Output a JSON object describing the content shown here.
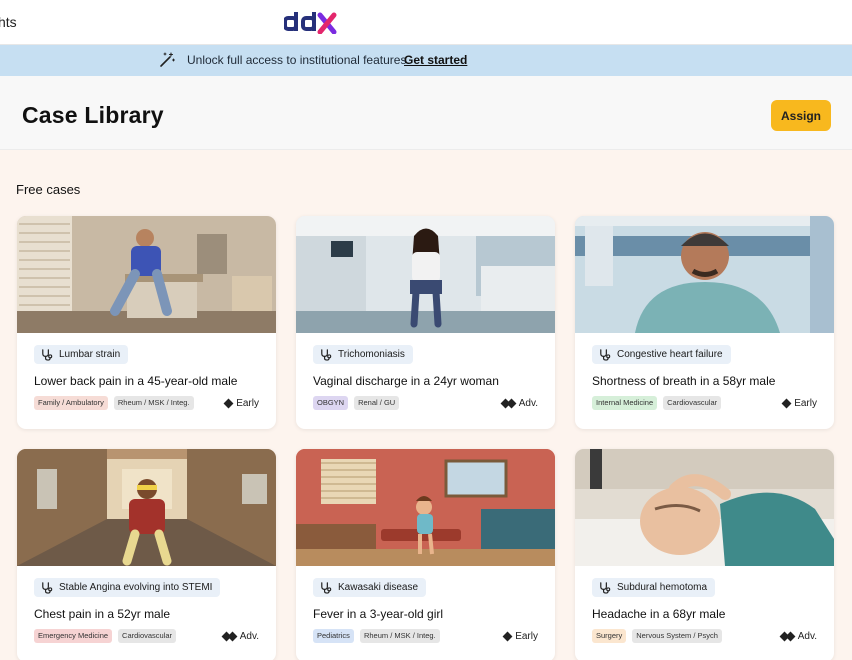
{
  "topbar": {
    "nav_fragment": "hts",
    "logo_text": "ddx"
  },
  "banner": {
    "text": "Unlock full access to institutional features.",
    "link": "Get started"
  },
  "header": {
    "title": "Case Library",
    "assign_label": "Assign"
  },
  "section": {
    "title": "Free cases"
  },
  "cards": [
    {
      "diagnosis": "Lumbar strain",
      "title": "Lower back pain in a 45-year-old male",
      "tags": [
        {
          "label": "Family / Ambulatory",
          "color": "#f6dcd6"
        },
        {
          "label": "Rheum / MSK / Integ.",
          "color": "#e6e6e6"
        }
      ],
      "level": "Early",
      "level_icon": "single-diamond-icon"
    },
    {
      "diagnosis": "Trichomoniasis",
      "title": "Vaginal discharge in a 24yr woman",
      "tags": [
        {
          "label": "OBGYN",
          "color": "#ddd6f1"
        },
        {
          "label": "Renal / GU",
          "color": "#e6e6e6"
        }
      ],
      "level": "Adv.",
      "level_icon": "double-diamond-icon"
    },
    {
      "diagnosis": "Congestive heart failure",
      "title": "Shortness of breath in a 58yr male",
      "tags": [
        {
          "label": "Internal Medicine",
          "color": "#d6efd9"
        },
        {
          "label": "Cardiovascular",
          "color": "#e6e6e6"
        }
      ],
      "level": "Early",
      "level_icon": "single-diamond-icon"
    },
    {
      "diagnosis": "Stable Angina evolving into STEMI",
      "title": "Chest pain in a 52yr male",
      "tags": [
        {
          "label": "Emergency Medicine",
          "color": "#f6d3d3"
        },
        {
          "label": "Cardiovascular",
          "color": "#e6e6e6"
        }
      ],
      "level": "Adv.",
      "level_icon": "double-diamond-icon"
    },
    {
      "diagnosis": "Kawasaki disease",
      "title": "Fever in a 3-year-old girl",
      "tags": [
        {
          "label": "Pediatrics",
          "color": "#d6e3f6"
        },
        {
          "label": "Rheum / MSK / Integ.",
          "color": "#e6e6e6"
        }
      ],
      "level": "Early",
      "level_icon": "single-diamond-icon"
    },
    {
      "diagnosis": "Subdural hemotoma",
      "title": "Headache in a 68yr male",
      "tags": [
        {
          "label": "Surgery",
          "color": "#fbe6cf"
        },
        {
          "label": "Nervous System / Psych",
          "color": "#e6e6e6"
        }
      ],
      "level": "Adv.",
      "level_icon": "double-diamond-icon"
    }
  ],
  "colors": {
    "accent_button": "#f8b81e",
    "banner_bg": "#c6dff2",
    "logo_blue": "#26307a",
    "logo_purple": "#7a2be0"
  }
}
